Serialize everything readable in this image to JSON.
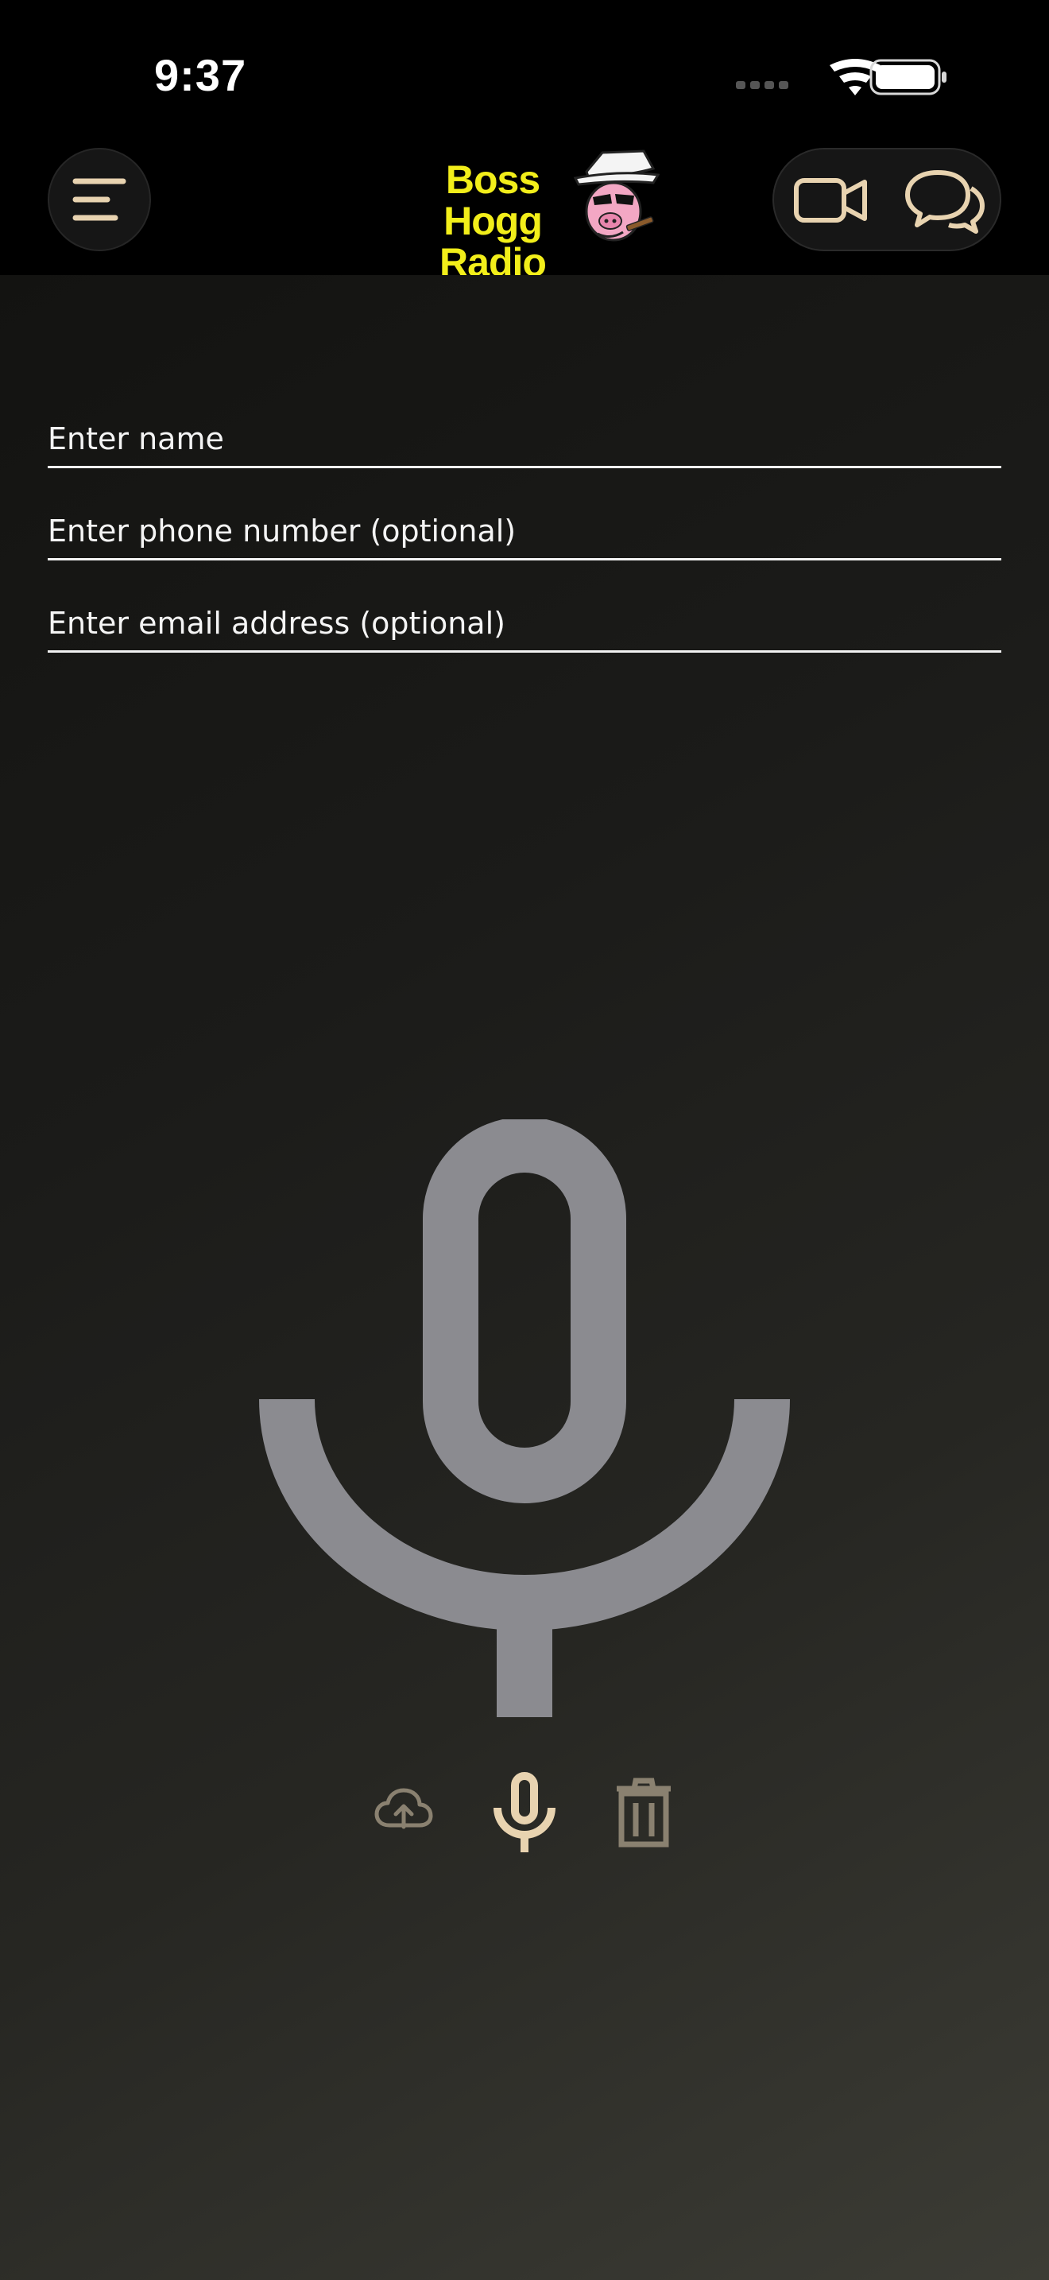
{
  "status_bar": {
    "time": "9:37",
    "icons": [
      "cellular-icon",
      "wifi-icon",
      "battery-icon"
    ]
  },
  "header": {
    "menu_icon": "menu-icon",
    "logo": {
      "line1": "Boss Hogg",
      "line2": "Radio",
      "mascot_icon": "pig-mascot-icon"
    },
    "actions": [
      {
        "name": "video-call",
        "icon": "video-camera-icon"
      },
      {
        "name": "chat",
        "icon": "chat-bubbles-icon"
      }
    ]
  },
  "form": {
    "name": {
      "value": "",
      "placeholder": "Enter name"
    },
    "phone": {
      "value": "",
      "placeholder": "Enter phone number (optional)"
    },
    "email": {
      "value": "",
      "placeholder": "Enter email address (optional)"
    }
  },
  "recorder": {
    "main_icon": "microphone-icon",
    "controls": [
      {
        "name": "upload",
        "icon": "cloud-upload-icon",
        "enabled": false
      },
      {
        "name": "record",
        "icon": "microphone-icon",
        "enabled": true
      },
      {
        "name": "delete",
        "icon": "trash-icon",
        "enabled": false
      }
    ]
  },
  "colors": {
    "accent": "#e8d3b0",
    "disabled": "#8a8170",
    "logo_yellow": "#f2ee1a",
    "mic_gray": "#8b8b90",
    "background": "#000000"
  }
}
